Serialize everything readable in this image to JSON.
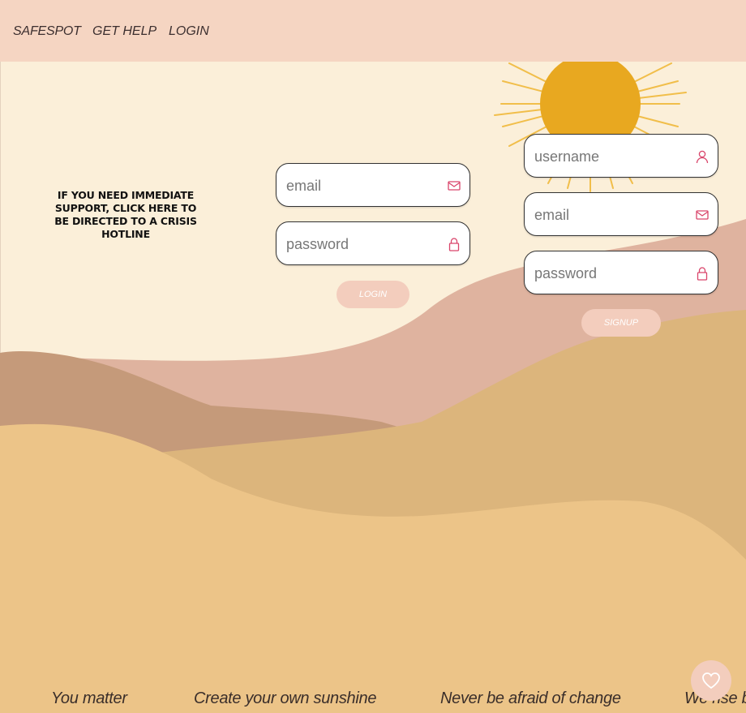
{
  "nav": {
    "brand": "SAFESPOT",
    "help": "GET HELP",
    "login": "LOGIN"
  },
  "crisis": {
    "text": "iF YOU NEED iMMEDiATE SUPPORT, CLiCK HERE TO BE DiRECTED TO A CRiSiS HOTLiNE"
  },
  "login_form": {
    "email_placeholder": "email",
    "password_placeholder": "password",
    "button_label": "LOGIN",
    "email_icon": "mail-icon",
    "password_icon": "lock-icon"
  },
  "signup_form": {
    "username_placeholder": "username",
    "email_placeholder": "email",
    "password_placeholder": "password",
    "button_label": "SIGNUP",
    "username_icon": "user-icon",
    "email_icon": "mail-icon",
    "password_icon": "lock-icon"
  },
  "quotes": [
    "You matter",
    "Create your own sunshine",
    "Never be afraid of change",
    "We rise by"
  ],
  "favorite_icon": "heart-icon",
  "colors": {
    "navbar": "#f5d5c2",
    "sky": "#fbefd9",
    "sun": "#e8a820",
    "icon_accent": "#d9456b",
    "button": "#f3cdbd"
  }
}
